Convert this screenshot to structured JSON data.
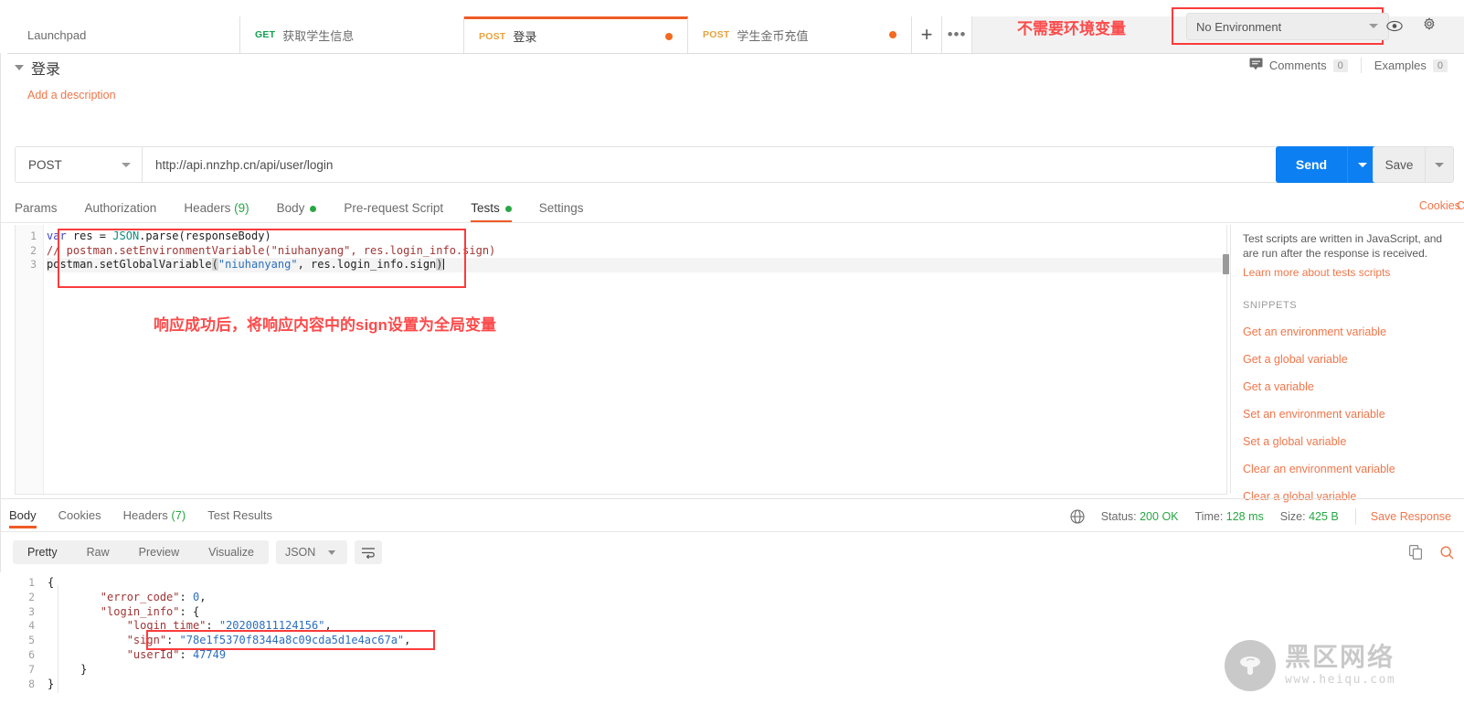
{
  "window": {
    "app": "Postman"
  },
  "tabbar": {
    "tabs": [
      {
        "label": "Launchpad",
        "method": "",
        "dirty": false,
        "active": false
      },
      {
        "label": "获取学生信息",
        "method": "GET",
        "dirty": false,
        "active": false
      },
      {
        "label": "登录",
        "method": "POST",
        "dirty": true,
        "active": true
      },
      {
        "label": "学生金币充值",
        "method": "POST",
        "dirty": true,
        "active": false
      }
    ],
    "new_tab_label": "+",
    "more_label": "•••"
  },
  "environment": {
    "selected": "No Environment",
    "eye_icon": "eye-icon",
    "gear_icon": "gear-icon"
  },
  "annotations": {
    "environment_note": "不需要环境变量",
    "script_note": "响应成功后，将响应内容中的sign设置为全局变量",
    "highlight_color": "#fb3b3b"
  },
  "request": {
    "name": "登录",
    "description_placeholder": "Add a description",
    "comments_label": "Comments",
    "comments_count": "0",
    "examples_label": "Examples",
    "examples_count": "0",
    "method": "POST",
    "url": "http://api.nnzhp.cn/api/user/login",
    "send_label": "Send",
    "save_label": "Save",
    "tabs": [
      {
        "label": "Params",
        "badge": "",
        "dot": false,
        "active": false
      },
      {
        "label": "Authorization",
        "badge": "",
        "dot": false,
        "active": false
      },
      {
        "label": "Headers",
        "badge": "(9)",
        "dot": false,
        "active": false
      },
      {
        "label": "Body",
        "badge": "",
        "dot": true,
        "active": false
      },
      {
        "label": "Pre-request Script",
        "badge": "",
        "dot": false,
        "active": false
      },
      {
        "label": "Tests",
        "badge": "",
        "dot": true,
        "active": true
      },
      {
        "label": "Settings",
        "badge": "",
        "dot": false,
        "active": false
      }
    ],
    "cookies_link": "Cookies",
    "code_link": "Co"
  },
  "tests_editor": {
    "line_numbers": [
      "1",
      "2",
      "3"
    ],
    "lines": [
      {
        "n": 1,
        "tokens": [
          {
            "t": "var",
            "c": "kw"
          },
          {
            "t": " res = ",
            "c": "pln"
          },
          {
            "t": "JSON",
            "c": "cls"
          },
          {
            "t": ".parse(responseBody)",
            "c": "pln"
          }
        ]
      },
      {
        "n": 2,
        "tokens": [
          {
            "t": "// postman.setEnvironmentVariable(\"niuhanyang\", res.login_info.sign)",
            "c": "cmt-c"
          }
        ]
      },
      {
        "n": 3,
        "tokens": [
          {
            "t": "postman.setGlobalVariable",
            "c": "pln"
          },
          {
            "t": "(",
            "c": "brk"
          },
          {
            "t": "\"niuhanyang\"",
            "c": "str"
          },
          {
            "t": ", res.login_info.sign",
            "c": "pln"
          },
          {
            "t": ")",
            "c": "brk"
          }
        ]
      }
    ]
  },
  "snippets": {
    "description": "Test scripts are written in JavaScript, and are run after the response is received.",
    "learn_more": "Learn more about tests scripts",
    "header": "SNIPPETS",
    "items": [
      "Get an environment variable",
      "Get a global variable",
      "Get a variable",
      "Set an environment variable",
      "Set a global variable",
      "Clear an environment variable",
      "Clear a global variable"
    ]
  },
  "response": {
    "tabs": [
      {
        "label": "Body",
        "badge": "",
        "active": true
      },
      {
        "label": "Cookies",
        "badge": "",
        "active": false
      },
      {
        "label": "Headers",
        "badge": "(7)",
        "active": false
      },
      {
        "label": "Test Results",
        "badge": "",
        "active": false
      }
    ],
    "globe_icon": "globe-icon",
    "status_label": "Status:",
    "status_value": "200 OK",
    "time_label": "Time:",
    "time_value": "128 ms",
    "size_label": "Size:",
    "size_value": "425 B",
    "save_response": "Save Response",
    "format_tabs": [
      {
        "label": "Pretty",
        "active": true
      },
      {
        "label": "Raw",
        "active": false
      },
      {
        "label": "Preview",
        "active": false
      },
      {
        "label": "Visualize",
        "active": false
      }
    ],
    "content_type": "JSON",
    "wrap_icon": "wrap-lines-icon",
    "copy_icon": "copy-icon",
    "search_icon": "search-icon",
    "line_numbers": [
      "1",
      "2",
      "3",
      "4",
      "5",
      "6",
      "7",
      "8"
    ],
    "body_lines": [
      {
        "n": 1,
        "tokens": [
          {
            "t": "{",
            "c": "jp"
          }
        ]
      },
      {
        "n": 2,
        "tokens": [
          {
            "t": "        ",
            "c": "jp"
          },
          {
            "t": "\"error_code\"",
            "c": "jk"
          },
          {
            "t": ": ",
            "c": "jp"
          },
          {
            "t": "0",
            "c": "jv-n"
          },
          {
            "t": ",",
            "c": "jp"
          }
        ]
      },
      {
        "n": 3,
        "tokens": [
          {
            "t": "        ",
            "c": "jp"
          },
          {
            "t": "\"login_info\"",
            "c": "jk"
          },
          {
            "t": ": {",
            "c": "jp"
          }
        ]
      },
      {
        "n": 4,
        "tokens": [
          {
            "t": "            ",
            "c": "jp"
          },
          {
            "t": "\"login_time\"",
            "c": "jk"
          },
          {
            "t": ": ",
            "c": "jp"
          },
          {
            "t": "\"20200811124156\"",
            "c": "jv-s"
          },
          {
            "t": ",",
            "c": "jp"
          }
        ]
      },
      {
        "n": 5,
        "tokens": [
          {
            "t": "            ",
            "c": "jp"
          },
          {
            "t": "\"sign\"",
            "c": "jk"
          },
          {
            "t": ": ",
            "c": "jp"
          },
          {
            "t": "\"78e1f5370f8344a8c09cda5d1e4ac67a\"",
            "c": "jv-s"
          },
          {
            "t": ",",
            "c": "jp"
          }
        ]
      },
      {
        "n": 6,
        "tokens": [
          {
            "t": "            ",
            "c": "jp"
          },
          {
            "t": "\"userId\"",
            "c": "jk"
          },
          {
            "t": ": ",
            "c": "jp"
          },
          {
            "t": "47749",
            "c": "jv-n"
          }
        ]
      },
      {
        "n": 7,
        "tokens": [
          {
            "t": "     ",
            "c": "jp"
          },
          {
            "t": "}",
            "c": "jp"
          }
        ]
      },
      {
        "n": 8,
        "tokens": [
          {
            "t": "}",
            "c": "jp"
          }
        ]
      }
    ]
  },
  "watermark": {
    "name": "黑区网络",
    "url": "www.heiqu.com"
  }
}
